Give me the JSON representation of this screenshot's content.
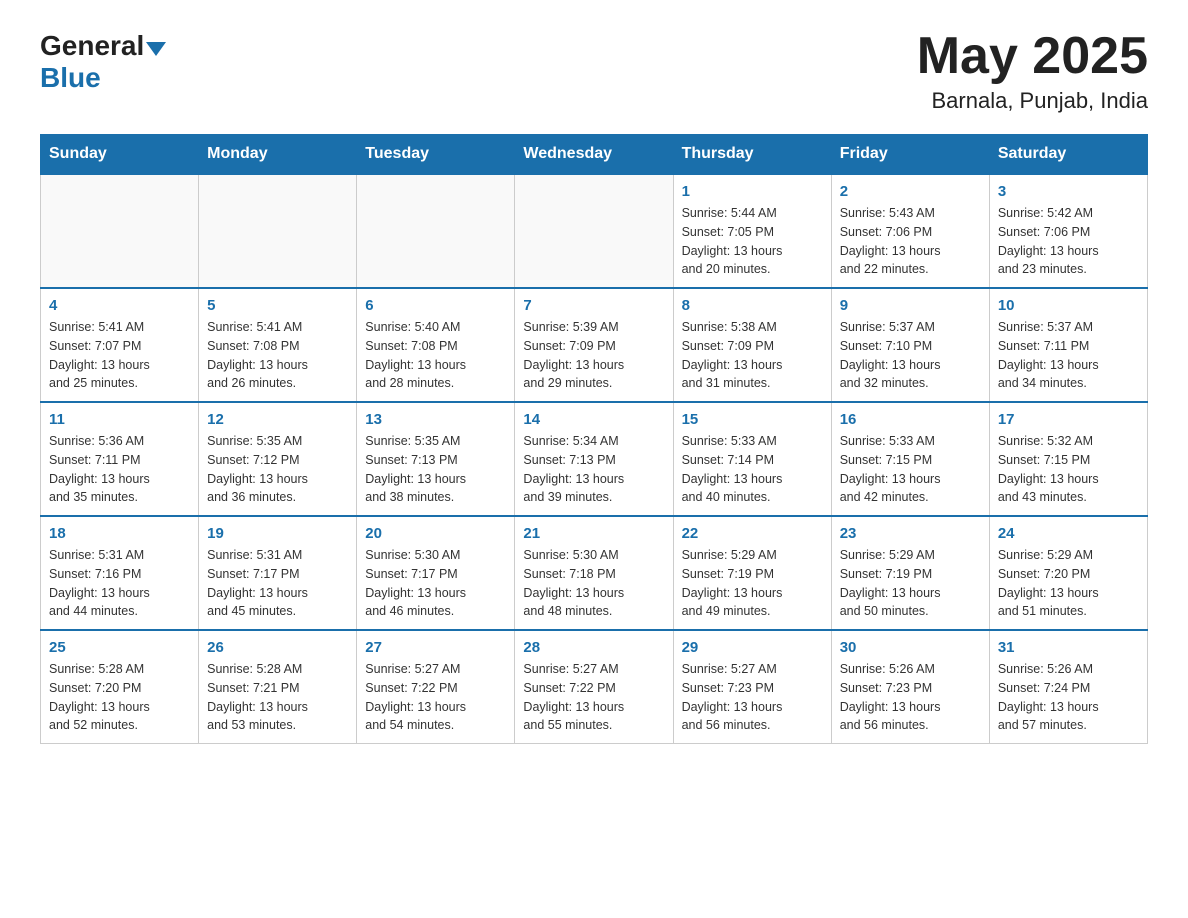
{
  "header": {
    "logo_general": "General",
    "logo_blue": "Blue",
    "month_title": "May 2025",
    "location": "Barnala, Punjab, India"
  },
  "weekdays": [
    "Sunday",
    "Monday",
    "Tuesday",
    "Wednesday",
    "Thursday",
    "Friday",
    "Saturday"
  ],
  "weeks": [
    [
      {
        "day": "",
        "info": ""
      },
      {
        "day": "",
        "info": ""
      },
      {
        "day": "",
        "info": ""
      },
      {
        "day": "",
        "info": ""
      },
      {
        "day": "1",
        "info": "Sunrise: 5:44 AM\nSunset: 7:05 PM\nDaylight: 13 hours\nand 20 minutes."
      },
      {
        "day": "2",
        "info": "Sunrise: 5:43 AM\nSunset: 7:06 PM\nDaylight: 13 hours\nand 22 minutes."
      },
      {
        "day": "3",
        "info": "Sunrise: 5:42 AM\nSunset: 7:06 PM\nDaylight: 13 hours\nand 23 minutes."
      }
    ],
    [
      {
        "day": "4",
        "info": "Sunrise: 5:41 AM\nSunset: 7:07 PM\nDaylight: 13 hours\nand 25 minutes."
      },
      {
        "day": "5",
        "info": "Sunrise: 5:41 AM\nSunset: 7:08 PM\nDaylight: 13 hours\nand 26 minutes."
      },
      {
        "day": "6",
        "info": "Sunrise: 5:40 AM\nSunset: 7:08 PM\nDaylight: 13 hours\nand 28 minutes."
      },
      {
        "day": "7",
        "info": "Sunrise: 5:39 AM\nSunset: 7:09 PM\nDaylight: 13 hours\nand 29 minutes."
      },
      {
        "day": "8",
        "info": "Sunrise: 5:38 AM\nSunset: 7:09 PM\nDaylight: 13 hours\nand 31 minutes."
      },
      {
        "day": "9",
        "info": "Sunrise: 5:37 AM\nSunset: 7:10 PM\nDaylight: 13 hours\nand 32 minutes."
      },
      {
        "day": "10",
        "info": "Sunrise: 5:37 AM\nSunset: 7:11 PM\nDaylight: 13 hours\nand 34 minutes."
      }
    ],
    [
      {
        "day": "11",
        "info": "Sunrise: 5:36 AM\nSunset: 7:11 PM\nDaylight: 13 hours\nand 35 minutes."
      },
      {
        "day": "12",
        "info": "Sunrise: 5:35 AM\nSunset: 7:12 PM\nDaylight: 13 hours\nand 36 minutes."
      },
      {
        "day": "13",
        "info": "Sunrise: 5:35 AM\nSunset: 7:13 PM\nDaylight: 13 hours\nand 38 minutes."
      },
      {
        "day": "14",
        "info": "Sunrise: 5:34 AM\nSunset: 7:13 PM\nDaylight: 13 hours\nand 39 minutes."
      },
      {
        "day": "15",
        "info": "Sunrise: 5:33 AM\nSunset: 7:14 PM\nDaylight: 13 hours\nand 40 minutes."
      },
      {
        "day": "16",
        "info": "Sunrise: 5:33 AM\nSunset: 7:15 PM\nDaylight: 13 hours\nand 42 minutes."
      },
      {
        "day": "17",
        "info": "Sunrise: 5:32 AM\nSunset: 7:15 PM\nDaylight: 13 hours\nand 43 minutes."
      }
    ],
    [
      {
        "day": "18",
        "info": "Sunrise: 5:31 AM\nSunset: 7:16 PM\nDaylight: 13 hours\nand 44 minutes."
      },
      {
        "day": "19",
        "info": "Sunrise: 5:31 AM\nSunset: 7:17 PM\nDaylight: 13 hours\nand 45 minutes."
      },
      {
        "day": "20",
        "info": "Sunrise: 5:30 AM\nSunset: 7:17 PM\nDaylight: 13 hours\nand 46 minutes."
      },
      {
        "day": "21",
        "info": "Sunrise: 5:30 AM\nSunset: 7:18 PM\nDaylight: 13 hours\nand 48 minutes."
      },
      {
        "day": "22",
        "info": "Sunrise: 5:29 AM\nSunset: 7:19 PM\nDaylight: 13 hours\nand 49 minutes."
      },
      {
        "day": "23",
        "info": "Sunrise: 5:29 AM\nSunset: 7:19 PM\nDaylight: 13 hours\nand 50 minutes."
      },
      {
        "day": "24",
        "info": "Sunrise: 5:29 AM\nSunset: 7:20 PM\nDaylight: 13 hours\nand 51 minutes."
      }
    ],
    [
      {
        "day": "25",
        "info": "Sunrise: 5:28 AM\nSunset: 7:20 PM\nDaylight: 13 hours\nand 52 minutes."
      },
      {
        "day": "26",
        "info": "Sunrise: 5:28 AM\nSunset: 7:21 PM\nDaylight: 13 hours\nand 53 minutes."
      },
      {
        "day": "27",
        "info": "Sunrise: 5:27 AM\nSunset: 7:22 PM\nDaylight: 13 hours\nand 54 minutes."
      },
      {
        "day": "28",
        "info": "Sunrise: 5:27 AM\nSunset: 7:22 PM\nDaylight: 13 hours\nand 55 minutes."
      },
      {
        "day": "29",
        "info": "Sunrise: 5:27 AM\nSunset: 7:23 PM\nDaylight: 13 hours\nand 56 minutes."
      },
      {
        "day": "30",
        "info": "Sunrise: 5:26 AM\nSunset: 7:23 PM\nDaylight: 13 hours\nand 56 minutes."
      },
      {
        "day": "31",
        "info": "Sunrise: 5:26 AM\nSunset: 7:24 PM\nDaylight: 13 hours\nand 57 minutes."
      }
    ]
  ]
}
